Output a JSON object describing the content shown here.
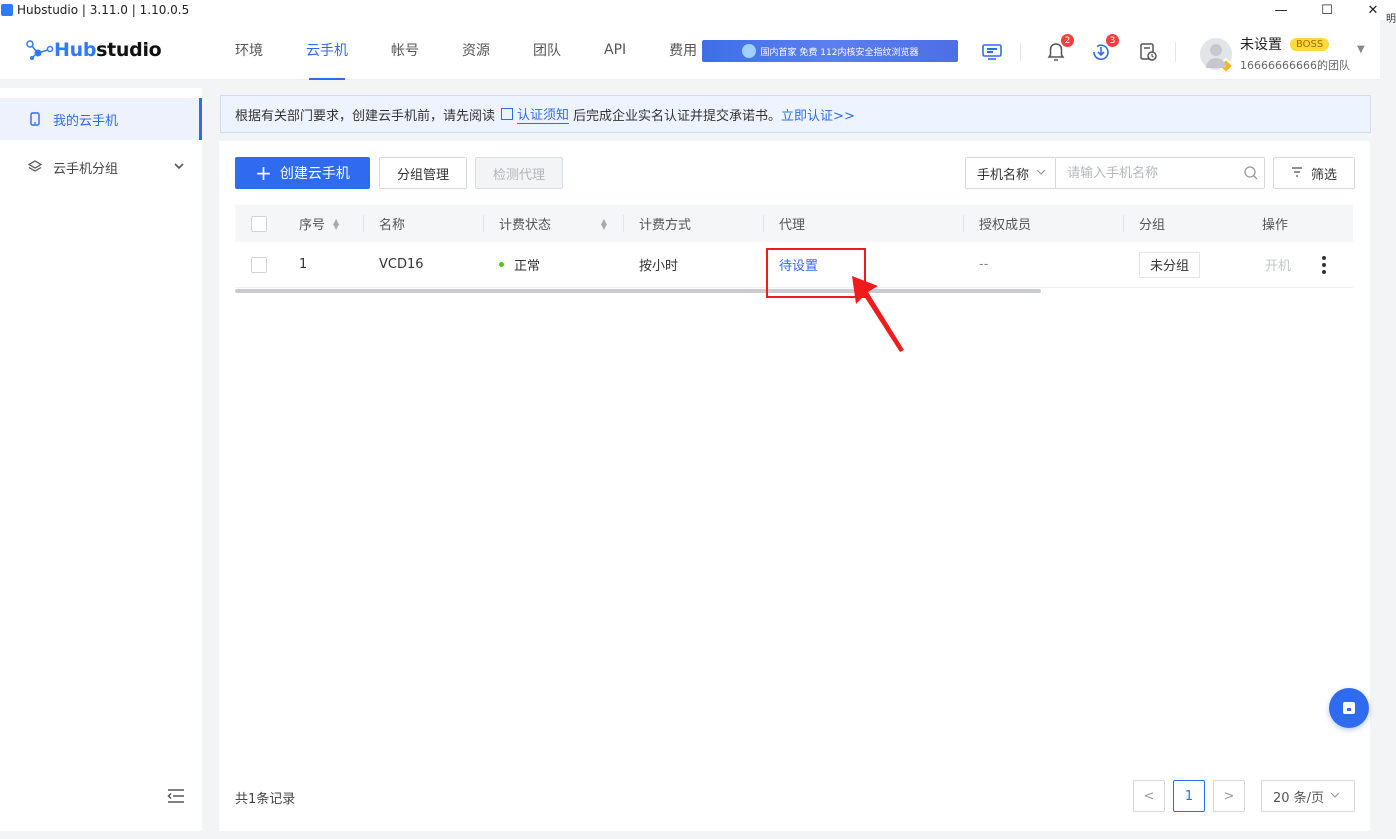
{
  "window": {
    "title": "Hubstudio | 3.11.0 | 1.10.0.5",
    "minimize": "—",
    "maximize": "☐",
    "close": "✕",
    "edge_text": "明"
  },
  "header": {
    "logo_prefix": "Hub",
    "logo_suffix": "studio",
    "nav": [
      {
        "label": "环境"
      },
      {
        "label": "云手机"
      },
      {
        "label": "帐号"
      },
      {
        "label": "资源"
      },
      {
        "label": "团队"
      },
      {
        "label": "API"
      },
      {
        "label": "费用"
      }
    ],
    "active_nav": "云手机",
    "banner_text": "国内首家 免费 112内核安全指纹浏览器",
    "icons": {
      "screen": "monitor-icon",
      "bell": "bell-icon",
      "download": "download-icon",
      "history": "history-icon"
    },
    "notifications_count": "2",
    "downloads_count": "3",
    "user": {
      "name": "未设置",
      "badge": "BOSS",
      "team": "16666666666的团队"
    }
  },
  "sidebar": {
    "items": [
      {
        "label": "我的云手机",
        "icon": "phone-icon"
      },
      {
        "label": "云手机分组",
        "icon": "layers-icon"
      }
    ]
  },
  "notice": {
    "prefix": "根据有关部门要求，创建云手机前，请先阅读",
    "doc_link": "认证须知",
    "middle": "后完成企业实名认证并提交承诺书。",
    "action_link": "立即认证>>"
  },
  "toolbar": {
    "create_label": "创建云手机",
    "group_manage_label": "分组管理",
    "check_proxy_label": "检测代理",
    "search_field": "手机名称",
    "search_placeholder": "请输入手机名称",
    "filter_label": "筛选"
  },
  "table": {
    "columns": [
      "序号",
      "名称",
      "计费状态",
      "计费方式",
      "代理",
      "授权成员",
      "分组",
      "操作"
    ],
    "rows": [
      {
        "index": "1",
        "name": "VCD16",
        "status": "正常",
        "billing": "按小时",
        "proxy": "待设置",
        "members": "--",
        "group": "未分组",
        "action": "开机"
      }
    ]
  },
  "footer": {
    "total": "共1条记录",
    "prev": "<",
    "current_page": "1",
    "next": ">",
    "page_size": "20 条/页"
  },
  "colors": {
    "accent": "#2f6bef",
    "status_ok": "#52c41a",
    "badge_red": "#f04040",
    "annotation_red": "#f01c1c"
  }
}
